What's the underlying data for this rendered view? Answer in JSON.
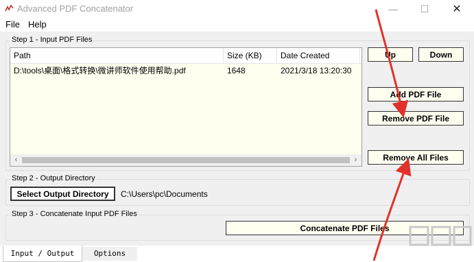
{
  "window": {
    "title": "Advanced PDF Concatenator",
    "icon": "app-logo-icon",
    "controls": {
      "minimize": "—",
      "maximize": "☐",
      "close": "✕"
    }
  },
  "menu": {
    "file": "File",
    "help": "Help"
  },
  "step1": {
    "legend": "Step 1 - Input PDF Files",
    "columns": {
      "path": "Path",
      "size": "Size (KB)",
      "date": "Date Created"
    },
    "rows": [
      {
        "path": "D:\\tools\\桌面\\格式转换\\微讲师软件使用帮助.pdf",
        "size": "1648",
        "date": "2021/3/18 13:20:30"
      }
    ],
    "scroll_left": "‹",
    "scroll_right": "›"
  },
  "buttons": {
    "up": "Up",
    "down": "Down",
    "add": "Add PDF File",
    "remove": "Remove PDF File",
    "remove_all": "Remove All Files"
  },
  "step2": {
    "legend": "Step 2 - Output Directory",
    "button": "Select Output Directory",
    "path": "C:\\Users\\pc\\Documents"
  },
  "step3": {
    "legend": "Step 3 - Concatenate Input PDF Files",
    "button": "Concatenate PDF Files"
  },
  "tabs": {
    "io": "Input / Output",
    "options": "Options"
  },
  "colors": {
    "background": "#f0f0f0",
    "list_bg": "#fffff0",
    "button_bg": "#fffff0",
    "annotation_arrow": "#e0312b"
  }
}
